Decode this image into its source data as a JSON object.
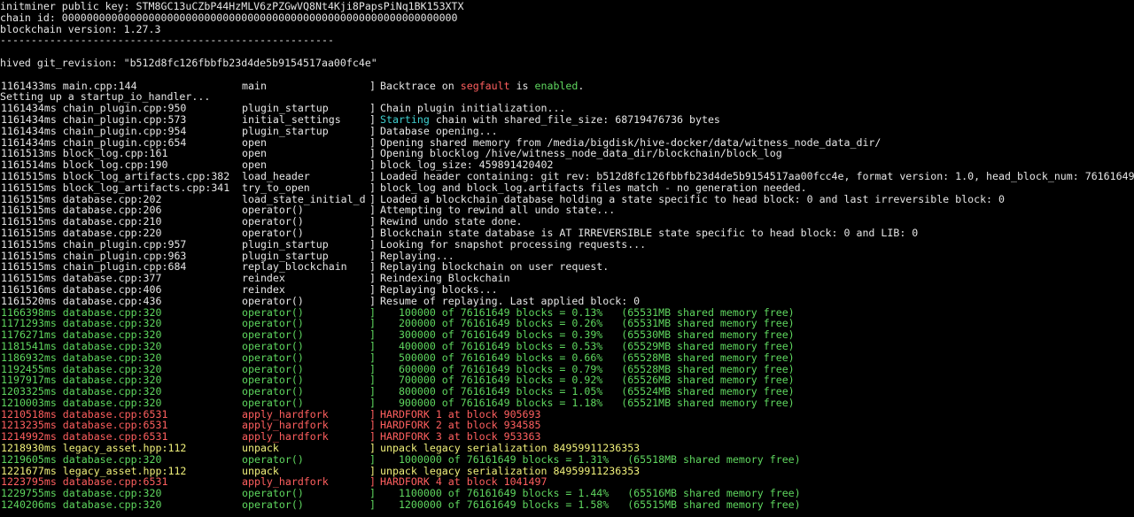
{
  "header": {
    "pubkey_line": "initminer public key: STM8GC13uCZbP44HzMLV6zPZGwVQ8Nt4Kji8PapsPiNq1BK153XTX",
    "chain_id_line": "chain id: 0000000000000000000000000000000000000000000000000000000000000000",
    "version_line": "blockchain version: 1.27.3",
    "separator": "------------------------------------------------------",
    "git_revision_line": "hived git_revision: \"b512d8fc126fbbfb23d4de5b9154517aa00fc4e\""
  },
  "colors": {
    "background": "#000000",
    "default": "#e6e6e6",
    "green": "#5fd75f",
    "red": "#ff5f5f",
    "yellow": "#f0f07a",
    "cyan": "#3fd0d0"
  },
  "pre_log": "Setting up a startup_io_handler...",
  "log": [
    {
      "ts": "1161433ms main.cpp:144",
      "fn": "main",
      "msg": "Backtrace on segfault is enabled.",
      "color": "white",
      "rich": [
        [
          "Backtrace on ",
          "white"
        ],
        [
          "segfault",
          "red"
        ],
        [
          " is ",
          "white"
        ],
        [
          "enabled",
          "green"
        ],
        [
          ".",
          "white"
        ]
      ]
    },
    {
      "ts": "1161434ms chain_plugin.cpp:950",
      "fn": "plugin_startup",
      "msg": "Chain plugin initialization...",
      "color": "white"
    },
    {
      "ts": "1161434ms chain_plugin.cpp:573",
      "fn": "initial_settings",
      "msg": "Starting chain with shared_file_size: 68719476736 bytes",
      "color": "white",
      "rich": [
        [
          "Starting",
          "cyan"
        ],
        [
          " chain with shared_file_size: 68719476736 bytes",
          "white"
        ]
      ]
    },
    {
      "ts": "1161434ms chain_plugin.cpp:954",
      "fn": "plugin_startup",
      "msg": "Database opening...",
      "color": "white"
    },
    {
      "ts": "1161434ms chain_plugin.cpp:654",
      "fn": "open",
      "msg": "Opening shared memory from /media/bigdisk/hive-docker/data/witness_node_data_dir/",
      "color": "white"
    },
    {
      "ts": "1161513ms block_log.cpp:161",
      "fn": "open",
      "msg": "Opening blocklog /hive/witness_node_data_dir/blockchain/block_log",
      "color": "white"
    },
    {
      "ts": "1161514ms block_log.cpp:190",
      "fn": "open",
      "msg": "block_log_size: 459891420402",
      "color": "white"
    },
    {
      "ts": "1161515ms block_log_artifacts.cpp:382",
      "fn": "load_header",
      "msg": "Loaded header containing: git rev: b512d8fc126fbbfb23d4de5b9154517aa00fcc4e, format version: 1.0, head_block_num: 76161649",
      "color": "white"
    },
    {
      "ts": "1161515ms block_log_artifacts.cpp:341",
      "fn": "try_to_open",
      "msg": "block_log and block_log.artifacts files match - no generation needed.",
      "color": "white"
    },
    {
      "ts": "1161515ms database.cpp:202",
      "fn": "load_state_initial_d",
      "msg": "Loaded a blockchain database holding a state specific to head block: 0 and last irreversible block: 0",
      "color": "white"
    },
    {
      "ts": "1161515ms database.cpp:206",
      "fn": "operator()",
      "msg": "Attempting to rewind all undo state...",
      "color": "white"
    },
    {
      "ts": "1161515ms database.cpp:210",
      "fn": "operator()",
      "msg": "Rewind undo state done.",
      "color": "white"
    },
    {
      "ts": "1161515ms database.cpp:220",
      "fn": "operator()",
      "msg": "Blockchain state database is AT IRREVERSIBLE state specific to head block: 0 and LIB: 0",
      "color": "white"
    },
    {
      "ts": "1161515ms chain_plugin.cpp:957",
      "fn": "plugin_startup",
      "msg": "Looking for snapshot processing requests...",
      "color": "white"
    },
    {
      "ts": "1161515ms chain_plugin.cpp:963",
      "fn": "plugin_startup",
      "msg": "Replaying...",
      "color": "white"
    },
    {
      "ts": "1161515ms chain_plugin.cpp:684",
      "fn": "replay_blockchain",
      "msg": "Replaying blockchain on user request.",
      "color": "white"
    },
    {
      "ts": "1161515ms database.cpp:377",
      "fn": "reindex",
      "msg": "Reindexing Blockchain",
      "color": "white"
    },
    {
      "ts": "1161516ms database.cpp:406",
      "fn": "reindex",
      "msg": "Replaying blocks...",
      "color": "white"
    },
    {
      "ts": "1161520ms database.cpp:436",
      "fn": "operator()",
      "msg": "Resume of replaying. Last applied block: 0",
      "color": "white"
    },
    {
      "ts": "1166398ms database.cpp:320",
      "fn": "operator()",
      "msg": "   100000 of 76161649 blocks = 0.13%   (65531MB shared memory free)",
      "color": "green"
    },
    {
      "ts": "1171293ms database.cpp:320",
      "fn": "operator()",
      "msg": "   200000 of 76161649 blocks = 0.26%   (65531MB shared memory free)",
      "color": "green"
    },
    {
      "ts": "1176271ms database.cpp:320",
      "fn": "operator()",
      "msg": "   300000 of 76161649 blocks = 0.39%   (65530MB shared memory free)",
      "color": "green"
    },
    {
      "ts": "1181541ms database.cpp:320",
      "fn": "operator()",
      "msg": "   400000 of 76161649 blocks = 0.53%   (65529MB shared memory free)",
      "color": "green"
    },
    {
      "ts": "1186932ms database.cpp:320",
      "fn": "operator()",
      "msg": "   500000 of 76161649 blocks = 0.66%   (65528MB shared memory free)",
      "color": "green"
    },
    {
      "ts": "1192455ms database.cpp:320",
      "fn": "operator()",
      "msg": "   600000 of 76161649 blocks = 0.79%   (65528MB shared memory free)",
      "color": "green"
    },
    {
      "ts": "1197917ms database.cpp:320",
      "fn": "operator()",
      "msg": "   700000 of 76161649 blocks = 0.92%   (65526MB shared memory free)",
      "color": "green"
    },
    {
      "ts": "1203325ms database.cpp:320",
      "fn": "operator()",
      "msg": "   800000 of 76161649 blocks = 1.05%   (65524MB shared memory free)",
      "color": "green"
    },
    {
      "ts": "1210003ms database.cpp:320",
      "fn": "operator()",
      "msg": "   900000 of 76161649 blocks = 1.18%   (65521MB shared memory free)",
      "color": "green"
    },
    {
      "ts": "1210518ms database.cpp:6531",
      "fn": "apply_hardfork",
      "msg": "HARDFORK 1 at block 905693",
      "color": "red"
    },
    {
      "ts": "1213235ms database.cpp:6531",
      "fn": "apply_hardfork",
      "msg": "HARDFORK 2 at block 934585",
      "color": "red"
    },
    {
      "ts": "1214992ms database.cpp:6531",
      "fn": "apply_hardfork",
      "msg": "HARDFORK 3 at block 953363",
      "color": "red"
    },
    {
      "ts": "1218930ms legacy_asset.hpp:112",
      "fn": "unpack",
      "msg": "unpack legacy serialization 84959911236353",
      "color": "yellow"
    },
    {
      "ts": "1219605ms database.cpp:320",
      "fn": "operator()",
      "msg": "   1000000 of 76161649 blocks = 1.31%   (65518MB shared memory free)",
      "color": "green"
    },
    {
      "ts": "1221677ms legacy_asset.hpp:112",
      "fn": "unpack",
      "msg": "unpack legacy serialization 84959911236353",
      "color": "yellow"
    },
    {
      "ts": "1223795ms database.cpp:6531",
      "fn": "apply_hardfork",
      "msg": "HARDFORK 4 at block 1041497",
      "color": "red"
    },
    {
      "ts": "1229755ms database.cpp:320",
      "fn": "operator()",
      "msg": "   1100000 of 76161649 blocks = 1.44%   (65516MB shared memory free)",
      "color": "green"
    },
    {
      "ts": "1240206ms database.cpp:320",
      "fn": "operator()",
      "msg": "   1200000 of 76161649 blocks = 1.58%   (65515MB shared memory free)",
      "color": "green"
    }
  ],
  "bracket": "]"
}
